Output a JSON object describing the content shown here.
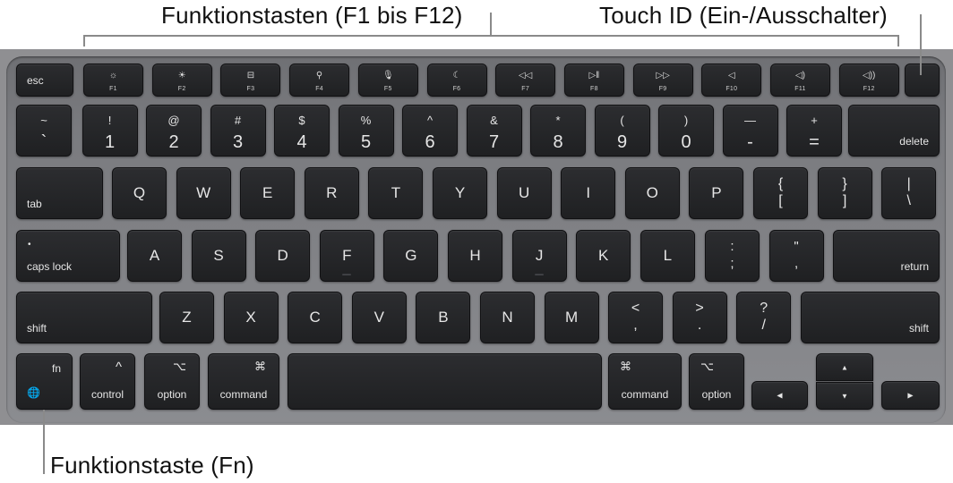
{
  "callouts": {
    "function_keys": "Funktionstasten (F1 bis F12)",
    "touch_id": "Touch ID (Ein-/Ausschalter)",
    "fn_key": "Funktionstaste (Fn)"
  },
  "rows": {
    "function": {
      "esc": "esc",
      "keys": [
        {
          "label": "F1",
          "icon": "☼",
          "icon_name": "brightness-down-icon"
        },
        {
          "label": "F2",
          "icon": "☀",
          "icon_name": "brightness-up-icon"
        },
        {
          "label": "F3",
          "icon": "⊟",
          "icon_name": "mission-control-icon"
        },
        {
          "label": "F4",
          "icon": "⚲",
          "icon_name": "spotlight-search-icon"
        },
        {
          "label": "F5",
          "icon": "🎙",
          "icon_name": "dictation-icon"
        },
        {
          "label": "F6",
          "icon": "☾",
          "icon_name": "do-not-disturb-icon"
        },
        {
          "label": "F7",
          "icon": "◁◁",
          "icon_name": "rewind-icon"
        },
        {
          "label": "F8",
          "icon": "▷‖",
          "icon_name": "play-pause-icon"
        },
        {
          "label": "F9",
          "icon": "▷▷",
          "icon_name": "fast-forward-icon"
        },
        {
          "label": "F10",
          "icon": "◁",
          "icon_name": "mute-icon"
        },
        {
          "label": "F11",
          "icon": "◁)",
          "icon_name": "volume-down-icon"
        },
        {
          "label": "F12",
          "icon": "◁))",
          "icon_name": "volume-up-icon"
        }
      ]
    },
    "number": {
      "keys": [
        {
          "top": "~",
          "bot": "`"
        },
        {
          "top": "!",
          "bot": "1"
        },
        {
          "top": "@",
          "bot": "2"
        },
        {
          "top": "#",
          "bot": "3"
        },
        {
          "top": "$",
          "bot": "4"
        },
        {
          "top": "%",
          "bot": "5"
        },
        {
          "top": "^",
          "bot": "6"
        },
        {
          "top": "&",
          "bot": "7"
        },
        {
          "top": "*",
          "bot": "8"
        },
        {
          "top": "(",
          "bot": "9"
        },
        {
          "top": ")",
          "bot": "0"
        },
        {
          "top": "—",
          "bot": "-"
        },
        {
          "top": "+",
          "bot": "="
        }
      ],
      "delete": "delete"
    },
    "qwerty": {
      "tab": "tab",
      "letters": [
        "Q",
        "W",
        "E",
        "R",
        "T",
        "Y",
        "U",
        "I",
        "O",
        "P"
      ],
      "brackets": [
        {
          "top": "{",
          "bot": "["
        },
        {
          "top": "}",
          "bot": "]"
        },
        {
          "top": "|",
          "bot": "\\"
        }
      ]
    },
    "home": {
      "caps_lock": "caps lock",
      "caps_indicator": "•",
      "letters": [
        "A",
        "S",
        "D",
        "F",
        "G",
        "H",
        "J",
        "K",
        "L"
      ],
      "punct": [
        {
          "top": ":",
          "bot": ";"
        },
        {
          "top": "\"",
          "bot": ","
        }
      ],
      "return": "return"
    },
    "shift": {
      "shift_left": "shift",
      "letters": [
        "Z",
        "X",
        "C",
        "V",
        "B",
        "N",
        "M"
      ],
      "punct": [
        {
          "top": "<",
          "bot": ","
        },
        {
          "top": ">",
          "bot": "."
        },
        {
          "top": "?",
          "bot": "/"
        }
      ],
      "shift_right": "shift"
    },
    "bottom": {
      "fn": "fn",
      "globe": "🌐",
      "control": "control",
      "control_sym": "^",
      "option": "option",
      "option_sym": "⌥",
      "command": "command",
      "command_sym": "⌘",
      "arrows": {
        "up": "▲",
        "down": "▼",
        "left": "◀",
        "right": "▶"
      }
    }
  }
}
